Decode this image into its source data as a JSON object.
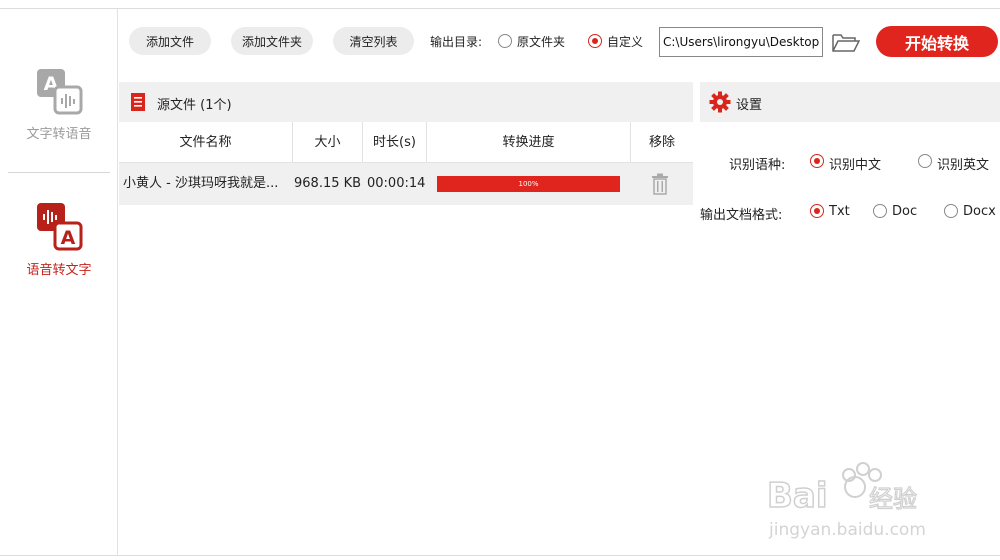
{
  "sidebar": {
    "tts_label": "文字转语音",
    "stt_label": "语音转文字"
  },
  "toolbar": {
    "add_file": "添加文件",
    "add_folder": "添加文件夹",
    "clear_list": "清空列表",
    "output_dir_label": "输出目录:",
    "option_source": "原文件夹",
    "option_custom": "自定义",
    "output_path": "C:\\Users\\lirongyu\\Desktop",
    "start": "开始转换"
  },
  "source": {
    "title": "源文件 (1个)",
    "columns": [
      "文件名称",
      "大小",
      "时长(s)",
      "转换进度",
      "移除"
    ],
    "rows": [
      {
        "name": "小黄人 - 沙琪玛呀我就是...",
        "size": "968.15 KB",
        "duration": "00:00:14",
        "progress": 100,
        "progress_label": "100%"
      }
    ]
  },
  "settings": {
    "title": "设置",
    "language_label": "识别语种:",
    "lang_zh": "识别中文",
    "lang_en": "识别英文",
    "format_label": "输出文档格式:",
    "fmt_txt": "Txt",
    "fmt_doc": "Doc",
    "fmt_docx": "Docx"
  },
  "colors": {
    "accent": "#e0241e",
    "panel": "#f0f0f0",
    "muted_icon": "#a8a8a8"
  },
  "icons": [
    "text-to-speech-icon",
    "speech-to-text-icon",
    "folder-open-icon",
    "document-icon",
    "gear-icon",
    "trash-icon"
  ]
}
